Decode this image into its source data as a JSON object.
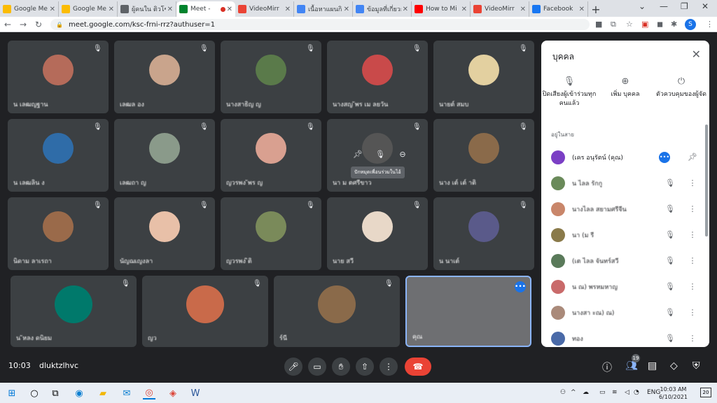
{
  "browser": {
    "tabs": [
      {
        "label": "Google Me",
        "color": "#fbbc04"
      },
      {
        "label": "Google Me",
        "color": "#fbbc04"
      },
      {
        "label": "ผู้คนใน ติวโซน",
        "color": "#5f6368"
      },
      {
        "label": "Meet -",
        "color": "#00832d",
        "active": true
      },
      {
        "label": "VideoMirr",
        "color": "#ea4335"
      },
      {
        "label": "เนื้อหาแผนกิ",
        "color": "#4285f4"
      },
      {
        "label": "ข้อมูลที่เกี่ยวกั",
        "color": "#4285f4"
      },
      {
        "label": "How to Mi",
        "color": "#ff0000"
      },
      {
        "label": "VideoMirr",
        "color": "#ea4335"
      },
      {
        "label": "Facebook",
        "color": "#1877f2"
      }
    ],
    "url": "meet.google.com/ksc-frni-rrz?authuser=1",
    "profile_initial": "S"
  },
  "tiles": [
    {
      "name": "น       เลฒญฐาน",
      "avcolor": "#b56b5a"
    },
    {
      "name": "         เลฒล       อง",
      "avcolor": "#c9a48c"
    },
    {
      "name": "นางสาธิญ       ญ",
      "avcolor": "#5a7a4a"
    },
    {
      "name": "นางสญ      ัพร เม       ลยวัน",
      "avcolor": "#c94a4a"
    },
    {
      "name": "นายต์      สมบ",
      "avcolor": "#e3d0a0"
    },
    {
      "name": "น   เลฒลิน        ง",
      "avcolor": "#2f6ca8"
    },
    {
      "name": "        เลฒถา        ญ",
      "avcolor": "#8a9a8a"
    },
    {
      "name": "ญวรพง       ัพร ญ",
      "avcolor": "#d9a090"
    },
    {
      "name": "นา              ม   ตศรีขาว",
      "avcolor": "#555"
    },
    {
      "name": "นาง เต์       เต์      าติ",
      "avcolor": "#8a6a4a"
    },
    {
      "name": "นิดาม ลาเรถา",
      "avcolor": "#9a6a4a"
    },
    {
      "name": "นัญฌเญงลา",
      "avcolor": "#e8c0a8"
    },
    {
      "name": "ญวรพง         ิติ",
      "avcolor": "#7a8a5a"
    },
    {
      "name": "นาย        สวี",
      "avcolor": "#e8d8c8"
    },
    {
      "name": "น      นาเต์",
      "avcolor": "#5a5a8a"
    },
    {
      "name": "น      ัหลง    ดนิยม",
      "avcolor": "#00796b"
    },
    {
      "name": "     ญว",
      "avcolor": "#c96a4a"
    },
    {
      "name": "ร์นี",
      "avcolor": "#8a6a4a"
    },
    {
      "name": "คุณ",
      "avcolor": "#6e6f72"
    }
  ],
  "hover_tooltip": "ปักหมุดเพื่อนร่วมในไอ้",
  "panel": {
    "title": "บุคคล",
    "actions": [
      {
        "icon": "mic-off-icon",
        "label": "ปิดเสียงผู้เข้าร่วมทุกคนแล้ว"
      },
      {
        "icon": "add-person-icon",
        "label": "เพิ่ม บุคคล"
      },
      {
        "icon": "toggle-icon",
        "label": "ตัวควบคุมของผู้จัด"
      }
    ],
    "section": "อยู่ในสาย",
    "people": [
      {
        "name": "(เคร อนุรัตน์ (คุณ)",
        "avcolor": "#7b3fc5",
        "self": true
      },
      {
        "name": "น      ไลล รักกู",
        "avcolor": "#6a8a5a"
      },
      {
        "name": "นางไลล สยามศรีจีน",
        "avcolor": "#c9866a"
      },
      {
        "name": "นา        (ม     รี",
        "avcolor": "#8a7a4a"
      },
      {
        "name": "(เต       ไลล จันทร์สวี",
        "avcolor": "#5a7a5a"
      },
      {
        "name": "น      ณ)    พรหมหาญ",
        "avcolor": "#c96a6a"
      },
      {
        "name": "นางสา  ะณ)     ณ)",
        "avcolor": "#aa8a7a"
      },
      {
        "name": "      ทอง",
        "avcolor": "#4a6aa8"
      }
    ]
  },
  "bottombar": {
    "time": "10:03",
    "code": "dluktzlhvc",
    "people_count": "19"
  },
  "taskbar": {
    "lang": "ENG",
    "clock_time": "10:03 AM",
    "clock_date": "6/10/2021",
    "notif_count": "20"
  }
}
